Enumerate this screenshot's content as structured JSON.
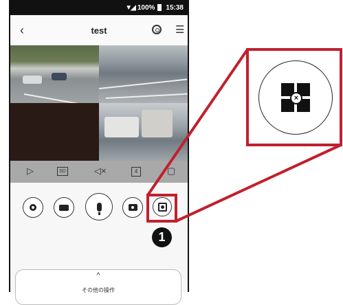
{
  "status_bar": {
    "battery": "100%",
    "time": "15:38"
  },
  "header": {
    "title": "test"
  },
  "icons": {
    "back": "‹",
    "menu": "☰",
    "play": "▷",
    "mute": "◁×",
    "page": "▢"
  },
  "controls": {
    "sd_label": "SD",
    "split_label": "4"
  },
  "callout": {
    "number": "1"
  },
  "bottom_panel": {
    "chevron": "^",
    "label": "その他の操作"
  },
  "colors": {
    "accent": "#c1202e",
    "control_bar": "#a9a9a9"
  }
}
